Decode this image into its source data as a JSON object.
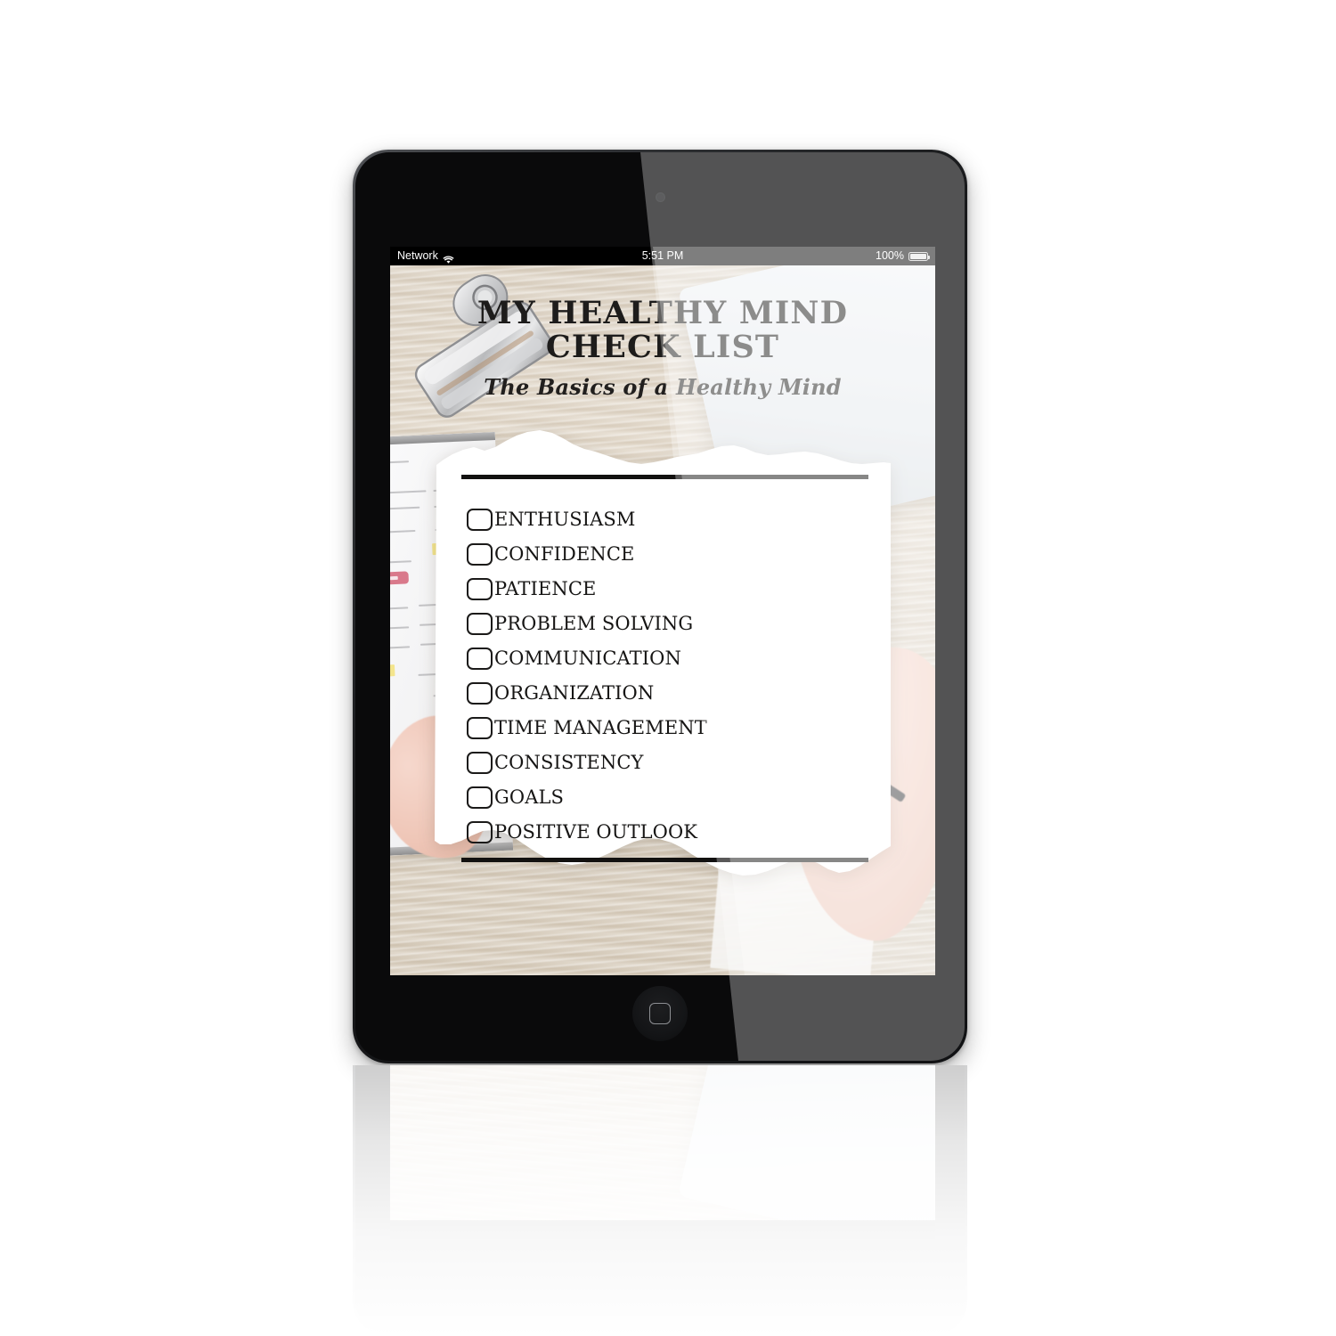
{
  "device": {
    "name": "tablet-mockup",
    "bezel_color": "#101113",
    "home_button": "home-button"
  },
  "statusbar": {
    "carrier": "Network",
    "wifi_icon": "wifi-icon",
    "time": "5:51 PM",
    "battery_percent": "100%",
    "battery_icon": "battery-icon"
  },
  "header": {
    "title_line1": "MY HEALTHY MIND",
    "title_line2": "CHECK  LIST",
    "subtitle": "The Basics of a Healthy Mind"
  },
  "checklist": {
    "items": [
      {
        "label": "ENTHUSIASM",
        "checked": false
      },
      {
        "label": "CONFIDENCE",
        "checked": false
      },
      {
        "label": "PATIENCE",
        "checked": false
      },
      {
        "label": "PROBLEM SOLVING",
        "checked": false
      },
      {
        "label": "COMMUNICATION",
        "checked": false
      },
      {
        "label": "ORGANIZATION",
        "checked": false
      },
      {
        "label": "TIME MANAGEMENT",
        "checked": false
      },
      {
        "label": "CONSISTENCY",
        "checked": false
      },
      {
        "label": "GOALS",
        "checked": false
      },
      {
        "label": "POSITIVE OUTLOOK",
        "checked": false
      }
    ]
  },
  "colors": {
    "page_background": "#ffffff",
    "wood_desk": "#ddd3c4",
    "paper": "#ffffff",
    "ink": "#121110",
    "bezel": "#0a0a0b"
  },
  "decor": {
    "binder_clip": "binder-clip-icon",
    "top_rule": "horizontal-rule",
    "bottom_rule": "horizontal-rule",
    "torn_paper": "torn-paper-sheet",
    "background_photo": "desk-with-planner-laptop-hands"
  }
}
